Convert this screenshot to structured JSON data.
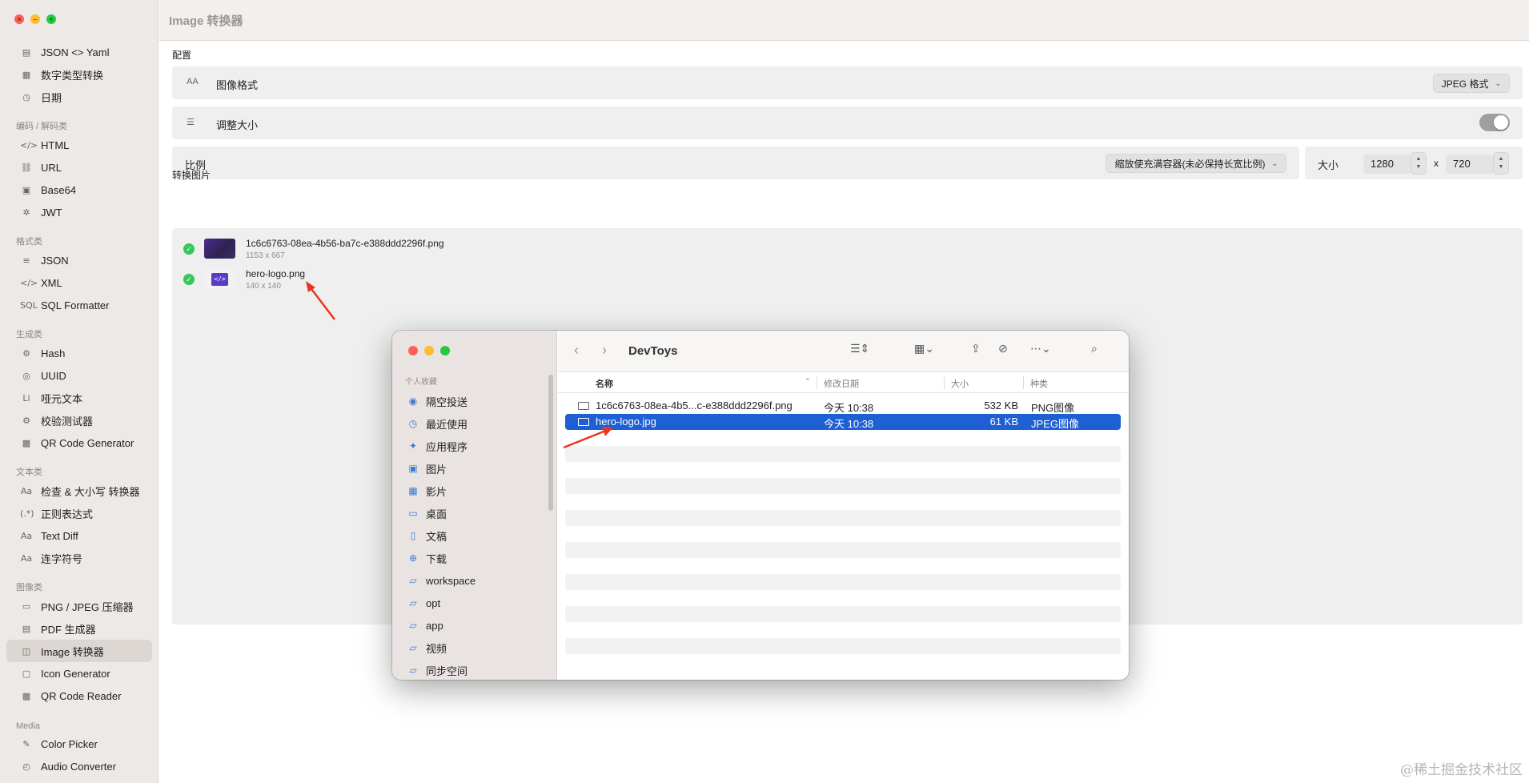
{
  "header": {
    "title": "Image 转换器"
  },
  "sidebar": {
    "items_top": [
      {
        "icon": "json-yaml-icon",
        "glyph": "▤",
        "label": "JSON <> Yaml"
      },
      {
        "icon": "number-convert-icon",
        "glyph": "▦",
        "label": "数字类型转换"
      },
      {
        "icon": "clock-icon",
        "glyph": "◷",
        "label": "日期"
      }
    ],
    "groups": [
      {
        "title": "编码 / 解码类",
        "items": [
          {
            "icon": "code-icon",
            "glyph": "</>",
            "label": "HTML"
          },
          {
            "icon": "link-icon",
            "glyph": "⛓",
            "label": "URL"
          },
          {
            "icon": "base64-icon",
            "glyph": "▣",
            "label": "Base64"
          },
          {
            "icon": "jwt-icon",
            "glyph": "✲",
            "label": "JWT"
          }
        ]
      },
      {
        "title": "格式类",
        "items": [
          {
            "icon": "list-icon",
            "glyph": "≡",
            "label": "JSON"
          },
          {
            "icon": "code-icon",
            "glyph": "</>",
            "label": "XML"
          },
          {
            "icon": "sql-icon",
            "glyph": "SQL",
            "label": "SQL Formatter"
          }
        ]
      },
      {
        "title": "生成类",
        "items": [
          {
            "icon": "gear-icon",
            "glyph": "⚙",
            "label": "Hash"
          },
          {
            "icon": "uuid-icon",
            "glyph": "◎",
            "label": "UUID"
          },
          {
            "icon": "lorem-icon",
            "glyph": "Li",
            "label": "哑元文本"
          },
          {
            "icon": "gear-icon",
            "glyph": "⚙",
            "label": "校验测试器"
          },
          {
            "icon": "qr-icon",
            "glyph": "▩",
            "label": "QR Code Generator"
          }
        ]
      },
      {
        "title": "文本类",
        "items": [
          {
            "icon": "text-case-icon",
            "glyph": "Aa",
            "label": "检查 & 大小写 转换器"
          },
          {
            "icon": "regex-icon",
            "glyph": "(.*)",
            "label": "正则表达式"
          },
          {
            "icon": "text-diff-icon",
            "glyph": "Aa",
            "label": "Text Diff"
          },
          {
            "icon": "hyphen-icon",
            "glyph": "Aa",
            "label": "连字符号"
          }
        ]
      },
      {
        "title": "图像类",
        "items": [
          {
            "icon": "image-icon",
            "glyph": "▭",
            "label": "PNG / JPEG 压缩器"
          },
          {
            "icon": "pdf-icon",
            "glyph": "▤",
            "label": "PDF 生成器"
          },
          {
            "icon": "image-convert-icon",
            "glyph": "◫",
            "label": "Image 转换器",
            "active": true
          },
          {
            "icon": "app-icon",
            "glyph": "▢",
            "label": "Icon Generator"
          },
          {
            "icon": "qr-reader-icon",
            "glyph": "▩",
            "label": "QR Code Reader"
          }
        ]
      },
      {
        "title": "Media",
        "items": [
          {
            "icon": "eyedropper-icon",
            "glyph": "✎",
            "label": "Color Picker"
          },
          {
            "icon": "audio-icon",
            "glyph": "◴",
            "label": "Audio Converter"
          }
        ]
      }
    ]
  },
  "config": {
    "section_title": "配置",
    "format": {
      "label": "图像格式",
      "icon_glyph": "AA",
      "value": "JPEG 格式"
    },
    "resize": {
      "label": "调整大小",
      "toggle_on": true
    },
    "ratio": {
      "label": "比例",
      "value": "缩放使充满容器(未必保持长宽比例)"
    },
    "size": {
      "label": "大小",
      "width": "1280",
      "separator": "x",
      "height": "720"
    }
  },
  "images": {
    "section_title": "转换图片",
    "files": [
      {
        "name": "1c6c6763-08ea-4b56-ba7c-e388ddd2296f.png",
        "dims": "1153 x 667"
      },
      {
        "name": "hero-logo.png",
        "dims": "140 x 140"
      }
    ]
  },
  "finder": {
    "title": "DevToys",
    "sidebar_group": "个人收藏",
    "sidebar_items": [
      {
        "icon": "airdrop-icon",
        "glyph": "◉",
        "label": "隔空投送"
      },
      {
        "icon": "recents-icon",
        "glyph": "◷",
        "label": "最近使用"
      },
      {
        "icon": "applications-icon",
        "glyph": "✦",
        "label": "应用程序"
      },
      {
        "icon": "pictures-icon",
        "glyph": "▣",
        "label": "图片"
      },
      {
        "icon": "movies-icon",
        "glyph": "▦",
        "label": "影片"
      },
      {
        "icon": "desktop-icon",
        "glyph": "▭",
        "label": "桌面"
      },
      {
        "icon": "documents-icon",
        "glyph": "▯",
        "label": "文稿"
      },
      {
        "icon": "downloads-icon",
        "glyph": "⊕",
        "label": "下载"
      },
      {
        "icon": "folder-icon",
        "glyph": "▱",
        "label": "workspace"
      },
      {
        "icon": "folder-icon",
        "glyph": "▱",
        "label": "opt"
      },
      {
        "icon": "folder-icon",
        "glyph": "▱",
        "label": "app"
      },
      {
        "icon": "folder-icon",
        "glyph": "▱",
        "label": "视频"
      },
      {
        "icon": "folder-icon",
        "glyph": "▱",
        "label": "同步空间"
      }
    ],
    "columns": {
      "name": "名称",
      "modified": "修改日期",
      "size": "大小",
      "kind": "种类"
    },
    "files": [
      {
        "name": "1c6c6763-08ea-4b5...c-e388ddd2296f.png",
        "modified": "今天 10:38",
        "size": "532 KB",
        "kind": "PNG图像",
        "selected": false
      },
      {
        "name": "hero-logo.jpg",
        "modified": "今天 10:38",
        "size": "61 KB",
        "kind": "JPEG图像",
        "selected": true
      }
    ]
  },
  "watermark": "@稀土掘金技术社区",
  "colors": {
    "accent": "#1e5fd4",
    "success": "#34c759",
    "arrow": "#e8371e"
  }
}
